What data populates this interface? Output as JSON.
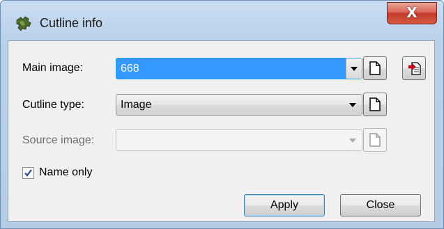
{
  "window": {
    "title": "Cutline info",
    "close_glyph": "X"
  },
  "main_image": {
    "label": "Main image:",
    "value": "668"
  },
  "cutline_type": {
    "label": "Cutline type:",
    "value": "Image"
  },
  "source_image": {
    "label": "Source image:",
    "value": ""
  },
  "name_only": {
    "label": "Name only",
    "checked": true
  },
  "buttons": {
    "apply": "Apply",
    "close": "Close"
  },
  "icons": {
    "app": "puzzle-icon",
    "new_doc": "new-document-icon",
    "import_doc": "import-document-icon"
  },
  "colors": {
    "selection": "#3399ff",
    "close_button": "#c43a2c",
    "import_arrow": "#d0021b"
  }
}
